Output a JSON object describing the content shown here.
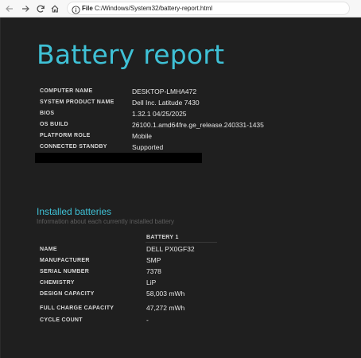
{
  "browser": {
    "file_label": "File",
    "url": "C:/Windows/System32/battery-report.html"
  },
  "report": {
    "title": "Battery report",
    "system": [
      {
        "label": "COMPUTER NAME",
        "value": "DESKTOP-LMHA472"
      },
      {
        "label": "SYSTEM PRODUCT NAME",
        "value": "Dell Inc. Latitude 7430"
      },
      {
        "label": "BIOS",
        "value": "1.32.1 04/25/2025"
      },
      {
        "label": "OS BUILD",
        "value": "26100.1.amd64fre.ge_release.240331-1435"
      },
      {
        "label": "PLATFORM ROLE",
        "value": "Mobile"
      },
      {
        "label": "CONNECTED STANDBY",
        "value": "Supported"
      }
    ],
    "installed": {
      "title": "Installed batteries",
      "subtitle": "Information about each currently installed battery",
      "column_header": "BATTERY 1",
      "rows": [
        {
          "label": "NAME",
          "value": "DELL PX0GF32"
        },
        {
          "label": "MANUFACTURER",
          "value": "SMP"
        },
        {
          "label": "SERIAL NUMBER",
          "value": "7378"
        },
        {
          "label": "CHEMISTRY",
          "value": "LiP"
        },
        {
          "label": "DESIGN CAPACITY",
          "value": "58,003 mWh"
        },
        {
          "label": "FULL CHARGE CAPACITY",
          "value": "47,272 mWh"
        },
        {
          "label": "CYCLE COUNT",
          "value": "-"
        }
      ]
    }
  },
  "colors": {
    "accent": "#3fc1d6",
    "background": "#1f1f1f"
  }
}
